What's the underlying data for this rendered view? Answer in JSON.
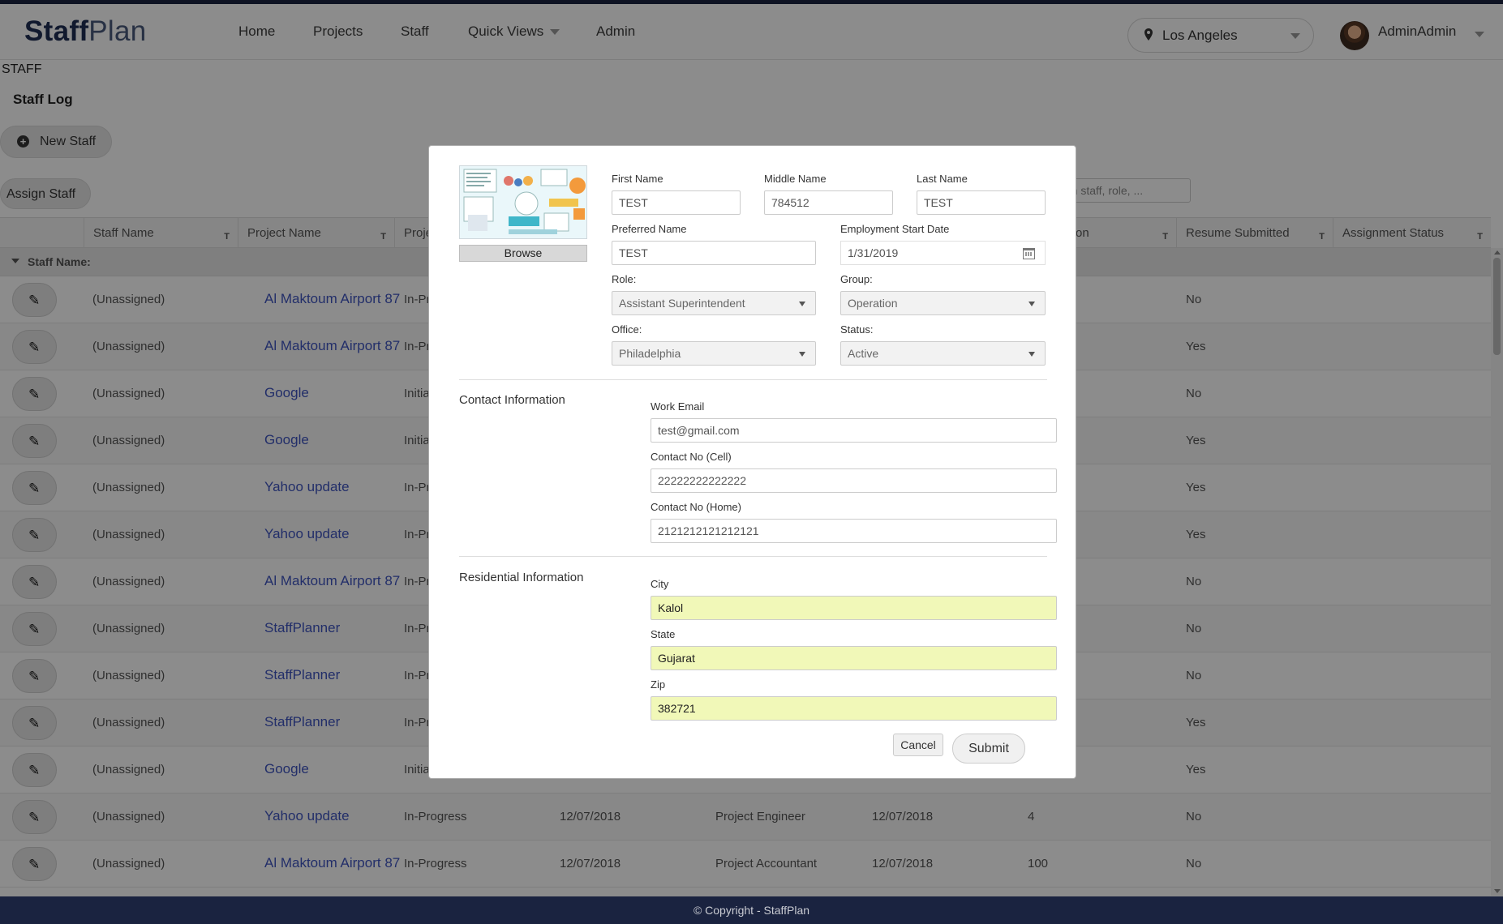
{
  "app": {
    "logo_bold": "Staff",
    "logo_light": "Plan",
    "nav": [
      "Home",
      "Projects",
      "Staff",
      "Quick Views",
      "Admin"
    ],
    "location": "Los Angeles",
    "user": "AdminAdmin"
  },
  "page": {
    "label": "STAFF",
    "title": "Staff Log",
    "new_staff": "New Staff",
    "assign_staff": "Assign Staff",
    "search_placeholder": "rch staff, role, ..."
  },
  "grid": {
    "headers": [
      "Staff Name",
      "Project Name",
      "Proje",
      "on",
      "Resume Submitted",
      "Assignment Status"
    ],
    "group_label": "Staff Name:",
    "rows": [
      {
        "staff": "(Unassigned)",
        "project": "Al Maktoum Airport 87",
        "status": "In-Pr",
        "date1": "",
        "role": "",
        "date2": "",
        "num": "",
        "resume": "No"
      },
      {
        "staff": "(Unassigned)",
        "project": "Al Maktoum Airport 87",
        "status": "In-Pr",
        "date1": "",
        "role": "",
        "date2": "",
        "num": "",
        "resume": "Yes"
      },
      {
        "staff": "(Unassigned)",
        "project": "Google",
        "status": "Initia",
        "date1": "",
        "role": "",
        "date2": "",
        "num": "",
        "resume": "No"
      },
      {
        "staff": "(Unassigned)",
        "project": "Google",
        "status": "Initia",
        "date1": "",
        "role": "",
        "date2": "",
        "num": "",
        "resume": "Yes"
      },
      {
        "staff": "(Unassigned)",
        "project": "Yahoo update",
        "status": "In-Pr",
        "date1": "",
        "role": "",
        "date2": "",
        "num": "",
        "resume": "Yes"
      },
      {
        "staff": "(Unassigned)",
        "project": "Yahoo update",
        "status": "In-Pr",
        "date1": "",
        "role": "",
        "date2": "",
        "num": "",
        "resume": "Yes"
      },
      {
        "staff": "(Unassigned)",
        "project": "Al Maktoum Airport 87",
        "status": "In-Pr",
        "date1": "",
        "role": "",
        "date2": "",
        "num": "",
        "resume": "No"
      },
      {
        "staff": "(Unassigned)",
        "project": "StaffPlanner",
        "status": "In-Pr",
        "date1": "",
        "role": "",
        "date2": "",
        "num": "",
        "resume": "No"
      },
      {
        "staff": "(Unassigned)",
        "project": "StaffPlanner",
        "status": "In-Pr",
        "date1": "",
        "role": "",
        "date2": "",
        "num": "",
        "resume": "No"
      },
      {
        "staff": "(Unassigned)",
        "project": "StaffPlanner",
        "status": "In-Pr",
        "date1": "",
        "role": "",
        "date2": "",
        "num": "",
        "resume": "Yes"
      },
      {
        "staff": "(Unassigned)",
        "project": "Google",
        "status": "Initia",
        "date1": "",
        "role": "",
        "date2": "",
        "num": "",
        "resume": "Yes"
      },
      {
        "staff": "(Unassigned)",
        "project": "Yahoo update",
        "status": "In-Progress",
        "date1": "12/07/2018",
        "role": "Project Engineer",
        "date2": "12/07/2018",
        "num": "4",
        "resume": "No"
      },
      {
        "staff": "(Unassigned)",
        "project": "Al Maktoum Airport 87",
        "status": "In-Progress",
        "date1": "12/07/2018",
        "role": "Project Accountant",
        "date2": "12/07/2018",
        "num": "100",
        "resume": "No"
      }
    ]
  },
  "footer": "© Copyright - StaffPlan",
  "modal": {
    "browse": "Browse",
    "first_name_label": "First Name",
    "first_name": "TEST",
    "middle_name_label": "Middle Name",
    "middle_name": "784512",
    "last_name_label": "Last Name",
    "last_name": "TEST",
    "preferred_name_label": "Preferred Name",
    "preferred_name": "TEST",
    "start_date_label": "Employment Start Date",
    "start_date": "1/31/2019",
    "role_label": "Role:",
    "role": "Assistant Superintendent",
    "group_label": "Group:",
    "group": "Operation",
    "office_label": "Office:",
    "office": "Philadelphia",
    "status_label": "Status:",
    "status": "Active",
    "contact_title": "Contact Information",
    "work_email_label": "Work Email",
    "work_email": "test@gmail.com",
    "cell_label": "Contact No (Cell)",
    "cell": "22222222222222",
    "home_label": "Contact No (Home)",
    "home": "2121212121212121",
    "residential_title": "Residential Information",
    "city_label": "City",
    "city": "Kalol",
    "state_label": "State",
    "state": "Gujarat",
    "zip_label": "Zip",
    "zip": "382721",
    "cancel": "Cancel",
    "submit": "Submit"
  }
}
